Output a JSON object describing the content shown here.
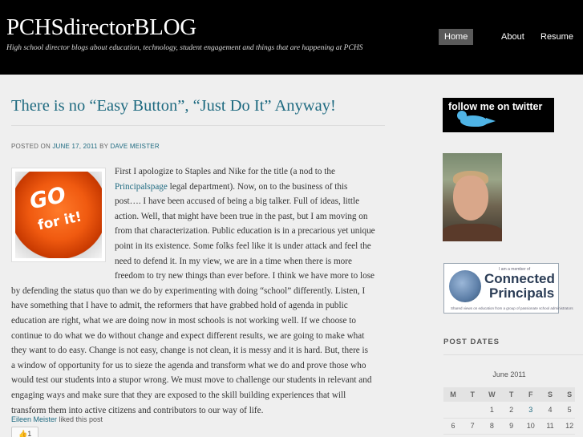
{
  "header": {
    "site_title": "PCHSdirectorBLOG",
    "description": "High school director blogs about education, technology, student engagement and things that are happening at PCHS",
    "nav": [
      "Home",
      "About",
      "Resume"
    ]
  },
  "post": {
    "title": "There is no “Easy Button”, “Just Do It” Anyway!",
    "meta": {
      "posted_on": "POSTED ON",
      "date": "JUNE 17, 2011",
      "by": "BY",
      "author": "DAVE MEISTER"
    },
    "image": {
      "line1": "GO",
      "line2": "for it!"
    },
    "lines": [
      {
        "pre": "First I apologize to Staples and Nike for the title (a nod to the",
        "link": "",
        "post": ""
      },
      {
        "pre": "",
        "link": "Principalspage",
        "post": " legal department).  Now, on to the business of this"
      },
      {
        "pre": "post…. I have been accused of being a big talker.  Full of ideas, little",
        "link": "",
        "post": ""
      },
      {
        "pre": "action.  Well, that might have been true in the past, but I am moving on",
        "link": "",
        "post": ""
      },
      {
        "pre": "from that characterization.  Public education is in a precarious yet unique",
        "link": "",
        "post": ""
      },
      {
        "pre": "point in its existence.  Some folks feel like it is under attack and feel the",
        "link": "",
        "post": ""
      },
      {
        "pre": "need to defend it.  In my view, we are in a time when there is more",
        "link": "",
        "post": ""
      },
      {
        "pre": "freedom to try new things than ever before.  I think we have more to lose",
        "link": "",
        "post": ""
      },
      {
        "pre": "by defending the status quo than we do by experimenting with doing “school” differently.  Listen, I",
        "link": "",
        "post": ""
      },
      {
        "pre": "have something that I have to admit, the reformers that have grabbed hold of agenda in public",
        "link": "",
        "post": ""
      },
      {
        "pre": "education are right, what we are doing now in most schools is not working well.  If we choose to",
        "link": "",
        "post": ""
      },
      {
        "pre": "continue to do what we do without change and expect different results, we are going to make what",
        "link": "",
        "post": ""
      },
      {
        "pre": "they want to do easy.  Change is not easy, change is not clean, it is messy and it is hard.  But, there is",
        "link": "",
        "post": ""
      },
      {
        "pre": "a window of opportunity for us to sieze the agenda and transform what we do and prove those who",
        "link": "",
        "post": ""
      },
      {
        "pre": "would test our students into a stupor wrong.  We must move to challenge our students in relevant and",
        "link": "",
        "post": ""
      },
      {
        "pre": "engaging ways and make sure that they are exposed to the skill building experiences that will",
        "link": "",
        "post": ""
      },
      {
        "pre": "transform them into active citizens and contributors to our way of life.",
        "link": "",
        "post": ""
      }
    ],
    "liked_by": "Eileen Meister",
    "liked_text": " liked this post",
    "like_count": "1",
    "like_icon": "thumbs-up-icon"
  },
  "sidebar": {
    "twitter": {
      "text": "follow me on twitter",
      "icon": "twitter-bird-icon"
    },
    "connected_principals": {
      "member": "I am a member of",
      "word1": "Connected",
      "word2": "Principals",
      "tagline": "Shared views on education from a group of passionate school administrators"
    },
    "post_dates_title": "POST DATES",
    "calendar": {
      "caption": "June 2011",
      "days": [
        "M",
        "T",
        "W",
        "T",
        "F",
        "S",
        "S"
      ],
      "weeks": [
        [
          {
            "d": "",
            "link": false
          },
          {
            "d": "",
            "link": false
          },
          {
            "d": "1",
            "link": false
          },
          {
            "d": "2",
            "link": false
          },
          {
            "d": "3",
            "link": true
          },
          {
            "d": "4",
            "link": false
          },
          {
            "d": "5",
            "link": false
          }
        ],
        [
          {
            "d": "6",
            "link": false
          },
          {
            "d": "7",
            "link": false
          },
          {
            "d": "8",
            "link": false
          },
          {
            "d": "9",
            "link": false
          },
          {
            "d": "10",
            "link": false
          },
          {
            "d": "11",
            "link": false
          },
          {
            "d": "12",
            "link": false
          }
        ]
      ]
    }
  },
  "colors": {
    "link": "#1e6a80",
    "header_bg": "#000000",
    "page_bg": "#efefef",
    "nav_active": "#5a5a5a"
  }
}
